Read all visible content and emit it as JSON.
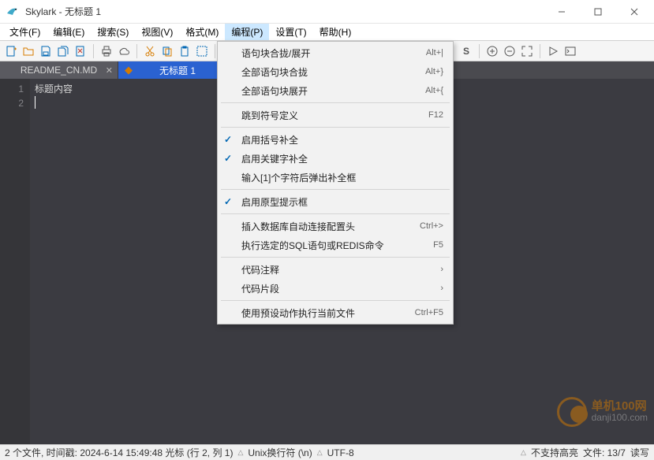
{
  "title": "Skylark - 无标题 1",
  "menubar": [
    "文件(F)",
    "编辑(E)",
    "搜索(S)",
    "视图(V)",
    "格式(M)",
    "编程(P)",
    "设置(T)",
    "帮助(H)"
  ],
  "active_menu_index": 5,
  "tabs": [
    {
      "label": "README_CN.MD",
      "active": false,
      "dirty": false
    },
    {
      "label": "无标题 1",
      "active": true,
      "dirty": true
    }
  ],
  "gutter_lines": [
    "1",
    "2"
  ],
  "editor_line1": "标题内容",
  "dropdown": [
    {
      "type": "item",
      "label": "语句块合拢/展开",
      "accel": "Alt+|"
    },
    {
      "type": "item",
      "label": "全部语句块合拢",
      "accel": "Alt+}"
    },
    {
      "type": "item",
      "label": "全部语句块展开",
      "accel": "Alt+{"
    },
    {
      "type": "sep"
    },
    {
      "type": "item",
      "label": "跳到符号定义",
      "accel": "F12"
    },
    {
      "type": "sep"
    },
    {
      "type": "item",
      "label": "启用括号补全",
      "checked": true
    },
    {
      "type": "item",
      "label": "启用关键字补全",
      "checked": true
    },
    {
      "type": "item",
      "label": "输入[1]个字符后弹出补全框"
    },
    {
      "type": "sep"
    },
    {
      "type": "item",
      "label": "启用原型提示框",
      "checked": true
    },
    {
      "type": "sep"
    },
    {
      "type": "item",
      "label": "插入数据库自动连接配置头",
      "accel": "Ctrl+>"
    },
    {
      "type": "item",
      "label": "执行选定的SQL语句或REDIS命令",
      "accel": "F5"
    },
    {
      "type": "sep"
    },
    {
      "type": "item",
      "label": "代码注释",
      "accel": "›"
    },
    {
      "type": "item",
      "label": "代码片段",
      "accel": "›"
    },
    {
      "type": "sep"
    },
    {
      "type": "item",
      "label": "使用预设动作执行当前文件",
      "accel": "Ctrl+F5"
    }
  ],
  "status": {
    "left": "2 个文件, 时间戳: 2024-6-14 15:49:48 光标 (行 2, 列 1)",
    "linebreak": "Unix换行符 (\\n)",
    "encoding": "UTF-8",
    "highlight": "不支持高亮",
    "filepos": "文件: 13/7",
    "readwrite": "读写"
  },
  "watermark": {
    "brand": "单机100网",
    "sub": "danji100.com"
  }
}
